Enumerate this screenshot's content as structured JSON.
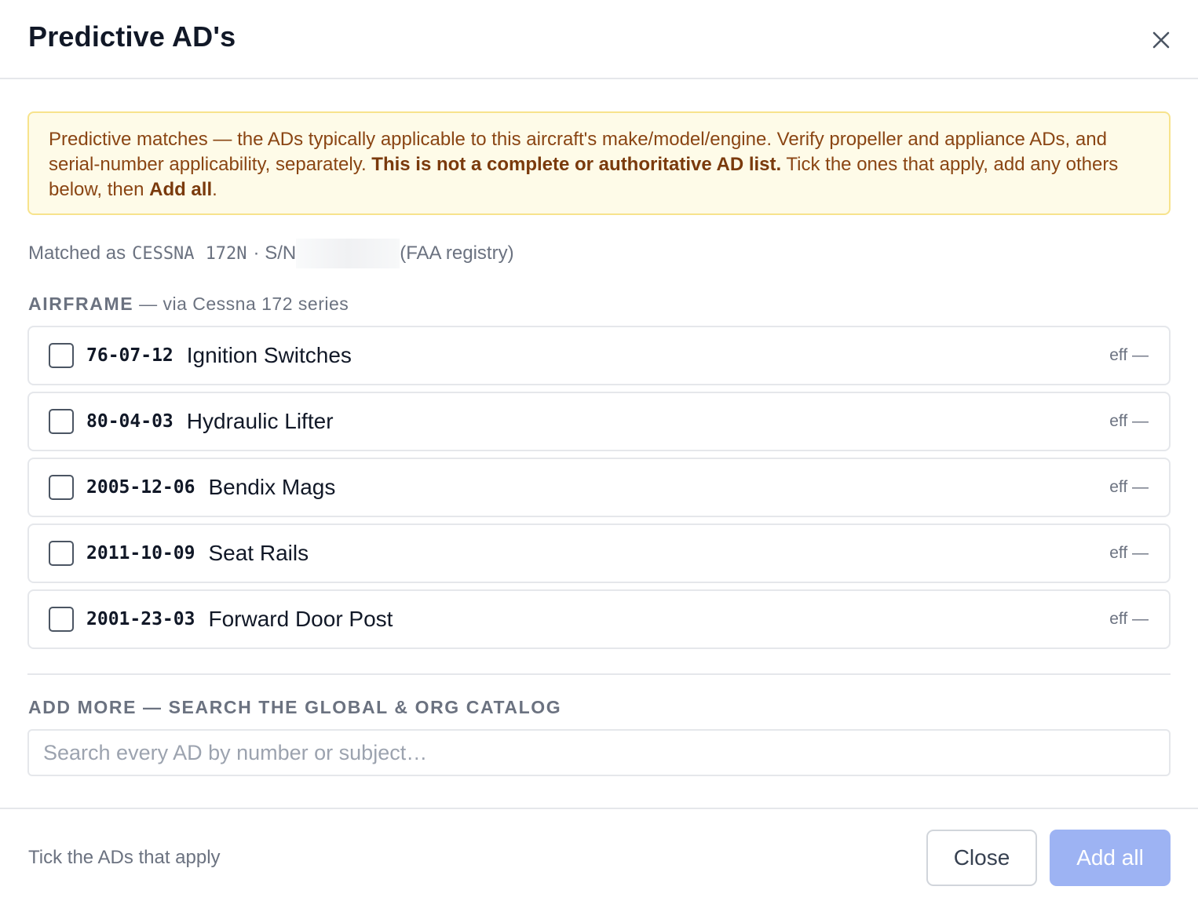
{
  "dialog": {
    "title": "Predictive AD's",
    "close_icon": "close-icon"
  },
  "warning": {
    "text_1": "Predictive matches — the ADs typically applicable to this aircraft's make/model/engine. Verify propeller and appliance ADs, and serial-number applicability, separately. ",
    "bold_1": "This is not a complete or authoritative AD list.",
    "text_2": " Tick the ones that apply, add any others below, then ",
    "bold_2": "Add all",
    "text_3": "."
  },
  "matched": {
    "prefix": "Matched as",
    "make": "CESSNA",
    "model": "172N",
    "sn_label": "· S/N",
    "source": "(FAA registry)"
  },
  "airframe_section": {
    "label": "AIRFRAME",
    "via": " — via Cessna 172 series"
  },
  "ads": [
    {
      "number": "76-07-12",
      "subject": "Ignition Switches",
      "eff": "eff —",
      "checked": false
    },
    {
      "number": "80-04-03",
      "subject": "Hydraulic Lifter",
      "eff": "eff —",
      "checked": false
    },
    {
      "number": "2005-12-06",
      "subject": "Bendix Mags",
      "eff": "eff —",
      "checked": false
    },
    {
      "number": "2011-10-09",
      "subject": "Seat Rails",
      "eff": "eff —",
      "checked": false
    },
    {
      "number": "2001-23-03",
      "subject": "Forward Door Post",
      "eff": "eff —",
      "checked": false
    }
  ],
  "add_more": {
    "label": "ADD MORE — SEARCH THE GLOBAL & ORG CATALOG",
    "search_placeholder": "Search every AD by number or subject…",
    "search_value": ""
  },
  "footer": {
    "hint": "Tick the ADs that apply",
    "close_label": "Close",
    "add_all_label": "Add all"
  },
  "colors": {
    "warning_bg": "#fefbe8",
    "warning_border": "#f7e38c",
    "warning_text": "#8a4513",
    "primary_disabled": "#9db3f3"
  }
}
